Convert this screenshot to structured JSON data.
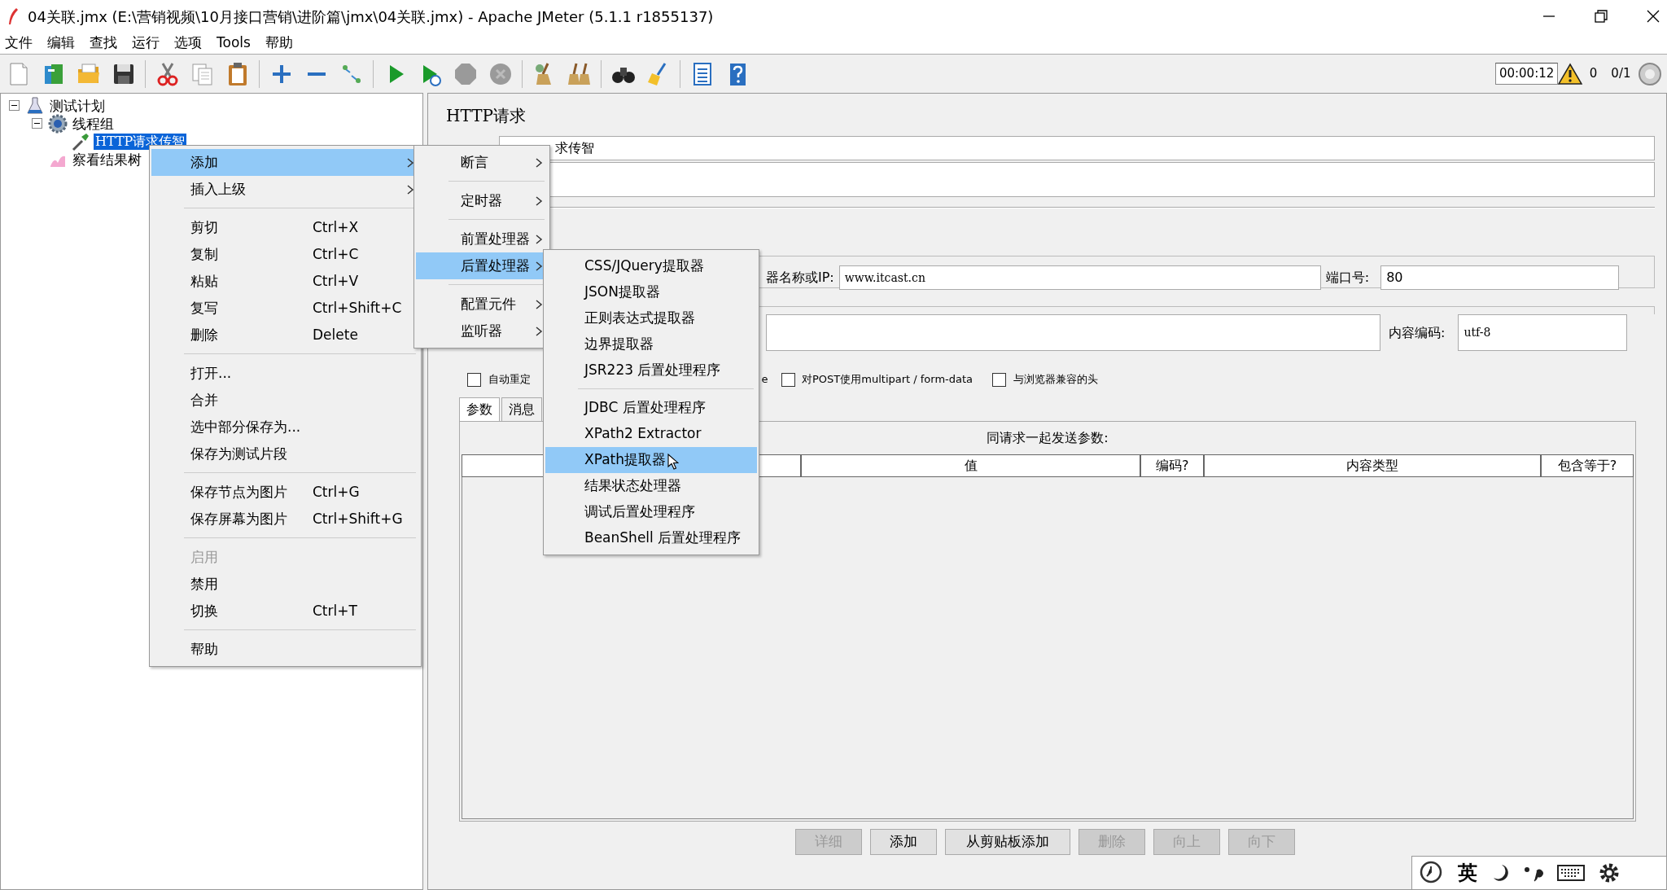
{
  "window": {
    "title": "04关联.jmx (E:\\营销视频\\10月接口营销\\进阶篇\\jmx\\04关联.jmx) - Apache JMeter (5.1.1 r1855137)"
  },
  "menu_bar": [
    "文件",
    "编辑",
    "查找",
    "运行",
    "选项",
    "Tools",
    "帮助"
  ],
  "toolbar": {
    "groups": [
      [
        {
          "kind": "new",
          "disabled": false
        },
        {
          "kind": "templates",
          "disabled": false
        },
        {
          "kind": "open",
          "disabled": false
        },
        {
          "kind": "save",
          "disabled": false
        }
      ],
      [
        {
          "kind": "cut",
          "disabled": false
        },
        {
          "kind": "copy",
          "disabled": false
        },
        {
          "kind": "paste",
          "disabled": false
        }
      ],
      [
        {
          "kind": "expand",
          "disabled": false
        },
        {
          "kind": "collapse",
          "disabled": false
        },
        {
          "kind": "toggle",
          "disabled": false
        }
      ],
      [
        {
          "kind": "start",
          "disabled": false
        },
        {
          "kind": "start_no_pause",
          "disabled": false
        },
        {
          "kind": "stop",
          "disabled": true
        },
        {
          "kind": "shutdown",
          "disabled": true
        }
      ],
      [
        {
          "kind": "clear",
          "disabled": false
        },
        {
          "kind": "clear_all",
          "disabled": false
        }
      ],
      [
        {
          "kind": "search",
          "disabled": false
        },
        {
          "kind": "reset_search",
          "disabled": false
        }
      ],
      [
        {
          "kind": "functions",
          "disabled": false
        },
        {
          "kind": "help",
          "disabled": false
        }
      ]
    ],
    "timer": "00:00:12",
    "warnings": "0",
    "threads": "0/1"
  },
  "tree": [
    {
      "label": "测试计划",
      "kind": "plan",
      "selected": false,
      "expanded": true,
      "children": [
        {
          "label": "线程组",
          "kind": "thread_group",
          "selected": false,
          "expanded": true,
          "children": [
            {
              "label": "HTTP请求传智",
              "kind": "sampler",
              "selected": true
            }
          ]
        },
        {
          "label": "察看结果树",
          "kind": "listener",
          "selected": false
        }
      ]
    }
  ],
  "context_menu": {
    "groups": [
      [
        {
          "label": "添加",
          "submenu": true,
          "selected": true,
          "disabled": false
        },
        {
          "label": "插入上级",
          "submenu": true,
          "selected": false,
          "disabled": false
        }
      ],
      [
        {
          "label": "剪切",
          "shortcut": "Ctrl+X",
          "submenu": false,
          "selected": false,
          "disabled": false
        },
        {
          "label": "复制",
          "shortcut": "Ctrl+C",
          "submenu": false,
          "selected": false,
          "disabled": false
        },
        {
          "label": "粘贴",
          "shortcut": "Ctrl+V",
          "submenu": false,
          "selected": false,
          "disabled": false
        },
        {
          "label": "复写",
          "shortcut": "Ctrl+Shift+C",
          "submenu": false,
          "selected": false,
          "disabled": false
        },
        {
          "label": "删除",
          "shortcut": "Delete",
          "submenu": false,
          "selected": false,
          "disabled": false
        }
      ],
      [
        {
          "label": "打开...",
          "submenu": false,
          "selected": false,
          "disabled": false
        },
        {
          "label": "合并",
          "submenu": false,
          "selected": false,
          "disabled": false
        },
        {
          "label": "选中部分保存为...",
          "submenu": false,
          "selected": false,
          "disabled": false
        },
        {
          "label": "保存为测试片段",
          "submenu": false,
          "selected": false,
          "disabled": false
        }
      ],
      [
        {
          "label": "保存节点为图片",
          "shortcut": "Ctrl+G",
          "submenu": false,
          "selected": false,
          "disabled": false
        },
        {
          "label": "保存屏幕为图片",
          "shortcut": "Ctrl+Shift+G",
          "submenu": false,
          "selected": false,
          "disabled": false
        }
      ],
      [
        {
          "label": "启用",
          "submenu": false,
          "selected": false,
          "disabled": true
        },
        {
          "label": "禁用",
          "submenu": false,
          "selected": false,
          "disabled": false
        },
        {
          "label": "切换",
          "shortcut": "Ctrl+T",
          "submenu": false,
          "selected": false,
          "disabled": false
        }
      ],
      [
        {
          "label": "帮助",
          "submenu": false,
          "selected": false,
          "disabled": false
        }
      ]
    ]
  },
  "add_submenu": {
    "groups": [
      [
        {
          "label": "断言",
          "selected": false
        }
      ],
      [
        {
          "label": "定时器",
          "selected": false
        }
      ],
      [
        {
          "label": "前置处理器",
          "selected": false
        },
        {
          "label": "后置处理器",
          "selected": true
        }
      ],
      [
        {
          "label": "配置元件",
          "selected": false
        },
        {
          "label": "监听器",
          "selected": false
        }
      ]
    ]
  },
  "postprocessor_submenu": {
    "groups": [
      [
        {
          "label": "CSS/JQuery提取器",
          "selected": false
        },
        {
          "label": "JSON提取器",
          "selected": false
        },
        {
          "label": "正则表达式提取器",
          "selected": false
        },
        {
          "label": "边界提取器",
          "selected": false
        },
        {
          "label": "JSR223 后置处理程序",
          "selected": false
        }
      ],
      [
        {
          "label": "JDBC 后置处理程序",
          "selected": false
        },
        {
          "label": "XPath2 Extractor",
          "selected": false
        },
        {
          "label": "XPath提取器",
          "selected": true
        },
        {
          "label": "结果状态处理器",
          "selected": false
        },
        {
          "label": "调试后置处理程序",
          "selected": false
        },
        {
          "label": "BeanShell 后置处理程序",
          "selected": false
        }
      ]
    ]
  },
  "http_request": {
    "title": "HTTP请求",
    "name_value": "求传智",
    "server_label": "器名称或IP:",
    "server_value": "www.itcast.cn",
    "port_label": "端口号:",
    "port_value": "80",
    "encoding_label": "内容编码:",
    "encoding_value": "utf-8",
    "options": [
      {
        "label": "自动重定",
        "checked": false
      },
      {
        "label": "对POST使用multipart / form-data",
        "checked": false
      },
      {
        "label": "与浏览器兼容的头",
        "checked": false
      }
    ],
    "option_fragment": "e",
    "tabs": [
      {
        "label": "参数",
        "selected": true
      },
      {
        "label": "消息",
        "selected": false
      }
    ],
    "params_title": "同请求一起发送参数:",
    "columns": [
      "值",
      "编码?",
      "内容类型",
      "包含等于?"
    ],
    "buttons": [
      {
        "label": "详细",
        "disabled": true
      },
      {
        "label": "添加",
        "disabled": false
      },
      {
        "label": "从剪贴板添加",
        "disabled": false
      },
      {
        "label": "删除",
        "disabled": true
      },
      {
        "label": "向上",
        "disabled": true
      },
      {
        "label": "向下",
        "disabled": true
      }
    ]
  },
  "ime_bar": {
    "mode": "英"
  }
}
